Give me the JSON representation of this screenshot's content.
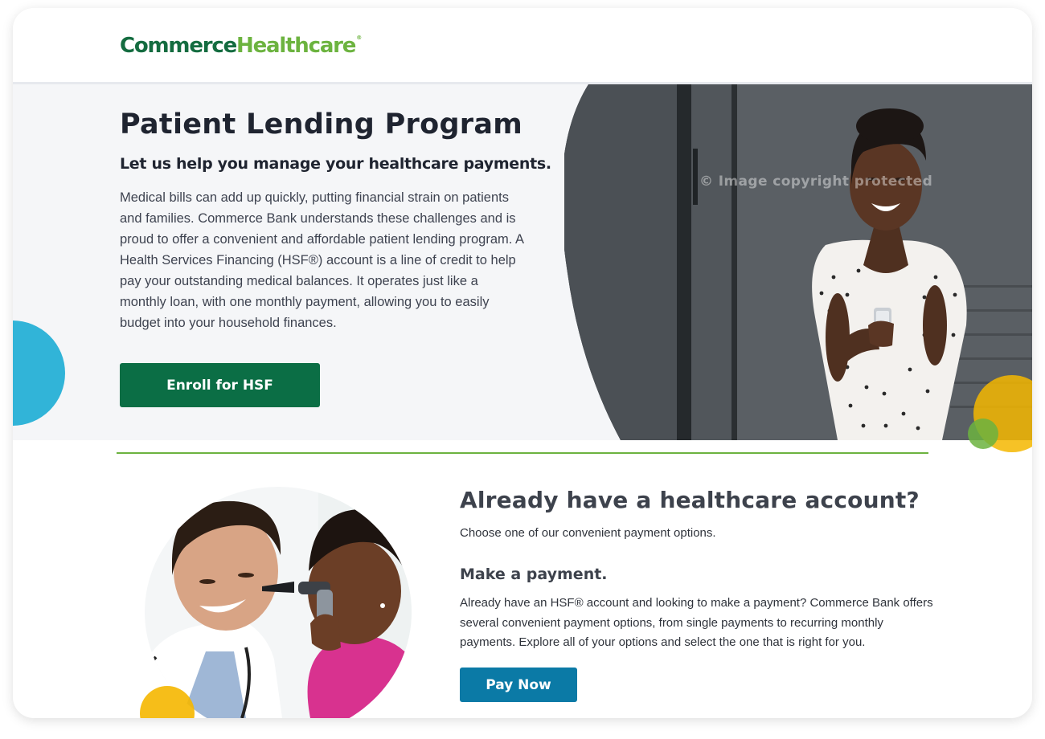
{
  "header": {
    "logo_part1": "Commerce",
    "logo_part2": "Healthcare",
    "logo_mark": "®"
  },
  "hero": {
    "title": "Patient Lending Program",
    "subtitle": "Let us help you manage your healthcare payments.",
    "body": "Medical bills can add up quickly, putting financial strain on patients and families. Commerce Bank understands these challenges and is proud to offer a convenient and affordable patient lending program. A Health Services Financing (HSF®) account is a line of credit to help pay your outstanding medical balances. It operates just like a monthly loan, with one monthly payment, allowing you to easily budget into your household finances.",
    "enroll_label": "Enroll for HSF",
    "watermark": "© Image copyright protected"
  },
  "account": {
    "title": "Already have a healthcare account?",
    "subtitle": "Choose one of our convenient payment options.",
    "payment_title": "Make a payment.",
    "payment_body": "Already have an HSF® account and looking to make a payment? Commerce Bank offers several convenient payment options, from single payments to recurring monthly payments. Explore all of your options and select the one that is right for you.",
    "pay_label": "Pay Now"
  },
  "colors": {
    "brand_dark_green": "#146c40",
    "brand_light_green": "#6cb33f",
    "enroll_button": "#0b6e45",
    "pay_button": "#0b7aa6",
    "accent_blue": "#31b4d8",
    "accent_yellow": "#f5b700"
  },
  "icons": {
    "hero_image": "woman-smiling-at-phone-photo",
    "doctor_image": "doctor-examining-child-ear-photo"
  }
}
